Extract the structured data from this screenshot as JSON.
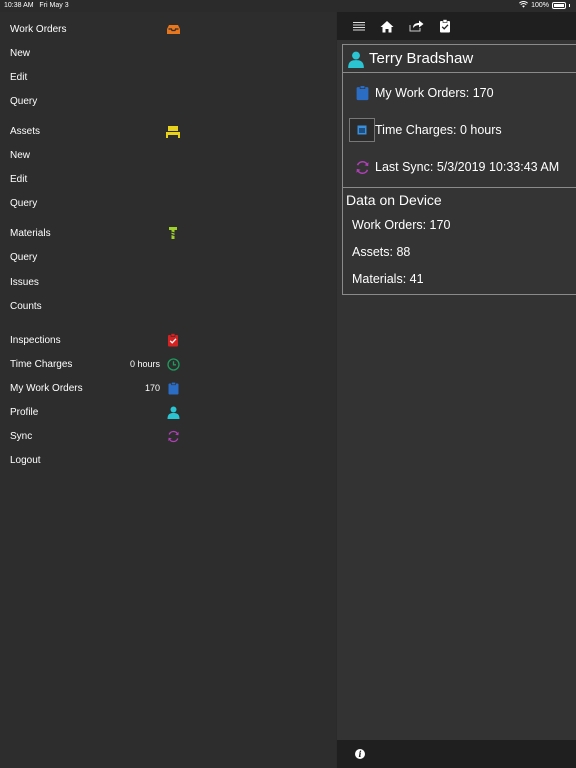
{
  "status_bar": {
    "time": "10:38 AM",
    "date": "Fri May 3",
    "battery": "100%"
  },
  "sidebar": {
    "sections": [
      {
        "label": "Work Orders",
        "icon": "inbox-icon",
        "icon_color": "#e8761c"
      },
      {
        "label": "New"
      },
      {
        "label": "Edit"
      },
      {
        "label": "Query"
      },
      {
        "label": "Assets",
        "icon": "assets-icon",
        "icon_color": "#e8d21c"
      },
      {
        "label": "New"
      },
      {
        "label": "Edit"
      },
      {
        "label": "Query"
      },
      {
        "label": "Materials",
        "icon": "materials-icon",
        "icon_color": "#9ed22a"
      },
      {
        "label": "Query"
      },
      {
        "label": "Issues"
      },
      {
        "label": "Counts"
      },
      {
        "label": "Inspections",
        "icon": "clipboard-check-icon",
        "icon_color": "#d42222"
      },
      {
        "label": "Time Charges",
        "value": "0 hours",
        "icon": "clock-icon",
        "icon_color": "#1e9b5e"
      },
      {
        "label": "My Work Orders",
        "value": "170",
        "icon": "clipboard-icon",
        "icon_color": "#2b6cc4"
      },
      {
        "label": "Profile",
        "icon": "user-icon",
        "icon_color": "#2bc4d2"
      },
      {
        "label": "Sync",
        "icon": "sync-icon",
        "icon_color": "#b03fb8"
      },
      {
        "label": "Logout"
      }
    ]
  },
  "toolbar": {
    "icons": [
      "menu-icon",
      "home-icon",
      "share-icon",
      "clipboard-check-icon"
    ]
  },
  "profile": {
    "name": "Terry Bradshaw"
  },
  "status": {
    "work_orders": "My Work Orders: 170",
    "time_charges": "Time Charges: 0 hours",
    "last_sync": "Last Sync: 5/3/2019 10:33:43 AM"
  },
  "data_on_device": {
    "title": "Data on Device",
    "work_orders": "Work Orders: 170",
    "assets": "Assets: 88",
    "materials": "Materials: 41"
  },
  "colors": {
    "background": "#2b2b2b",
    "toolbar": "#1f1f1f",
    "card_border": "#8a8a8a"
  }
}
